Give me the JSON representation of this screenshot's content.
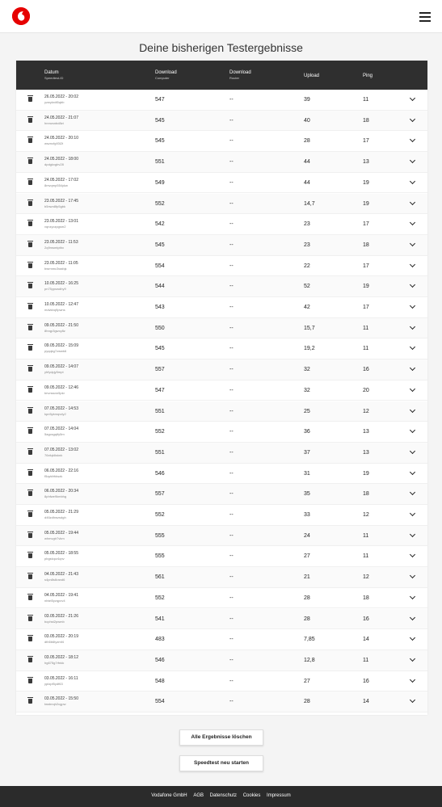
{
  "header": {
    "logo_icon": "vodafone-logo-icon",
    "menu_icon": "hamburger-menu-icon"
  },
  "page": {
    "title": "Deine bisherigen Testergebnisse"
  },
  "table": {
    "columns": {
      "date": "Datum",
      "date_sub": "Speedtest-ID",
      "download": "Download",
      "download_sub": "Computer",
      "router": "Download",
      "router_sub": "Router",
      "upload": "Upload",
      "ping": "Ping"
    },
    "rows": [
      {
        "date": "26.05.2022 - 20:02",
        "id": "yzwykrdt5qbb",
        "dl": "547",
        "router": "--",
        "up": "39",
        "ping": "11"
      },
      {
        "date": "24.05.2022 - 21:07",
        "id": "hnmzsnbd8zt",
        "dl": "545",
        "router": "--",
        "up": "40",
        "ping": "18"
      },
      {
        "date": "24.05.2022 - 20:10",
        "id": "wszncfg93i2t",
        "dl": "545",
        "router": "--",
        "up": "28",
        "ping": "17"
      },
      {
        "date": "24.05.2022 - 18:00",
        "id": "dpdgkxgbv28",
        "dl": "551",
        "router": "--",
        "up": "44",
        "ping": "13"
      },
      {
        "date": "24.05.2022 - 17:02",
        "id": "8mvqmp554ykw",
        "dl": "549",
        "router": "--",
        "up": "44",
        "ping": "19"
      },
      {
        "date": "23.05.2022 - 17:45",
        "id": "b5nwn8fp5gbk",
        "dl": "552",
        "router": "--",
        "up": "14,7",
        "ping": "19"
      },
      {
        "date": "23.05.2022 - 13:01",
        "id": "vqnzyczpgsm2",
        "dl": "542",
        "router": "--",
        "up": "23",
        "ping": "17"
      },
      {
        "date": "23.05.2022 - 11:53",
        "id": "2q9msmtpthx",
        "dl": "545",
        "router": "--",
        "up": "23",
        "ping": "18"
      },
      {
        "date": "23.05.2022 - 11:05",
        "id": "bwrmmc3wsfqk",
        "dl": "554",
        "router": "--",
        "up": "22",
        "ping": "17"
      },
      {
        "date": "10.05.2022 - 16:25",
        "id": "pn75ypswdhy9",
        "dl": "544",
        "router": "--",
        "up": "52",
        "ping": "19"
      },
      {
        "date": "10.05.2022 - 12:47",
        "id": "mdvkbq9pwns",
        "dl": "543",
        "router": "--",
        "up": "42",
        "ping": "17"
      },
      {
        "date": "09.05.2022 - 21:50",
        "id": "8hrqp3gwcy8z",
        "dl": "550",
        "router": "--",
        "up": "15,7",
        "ping": "11"
      },
      {
        "date": "09.05.2022 - 15:09",
        "id": "pyqqkg7zwwk6",
        "dl": "545",
        "router": "--",
        "up": "19,2",
        "ping": "11"
      },
      {
        "date": "09.05.2022 - 14:07",
        "id": "yhfydpjy5mpt",
        "dl": "557",
        "router": "--",
        "up": "32",
        "ping": "16"
      },
      {
        "date": "09.05.2022 - 12:46",
        "id": "tmvnssnn5pkr",
        "dl": "547",
        "router": "--",
        "up": "32",
        "ping": "20"
      },
      {
        "date": "07.05.2022 - 14:53",
        "id": "kpn5ykmqvdy2",
        "dl": "551",
        "router": "--",
        "up": "25",
        "ping": "12"
      },
      {
        "date": "07.05.2022 - 14:04",
        "id": "5agcsgqify5m",
        "dl": "552",
        "router": "--",
        "up": "36",
        "ping": "13"
      },
      {
        "date": "07.05.2022 - 13:02",
        "id": "76xfqk6sknk",
        "dl": "551",
        "router": "--",
        "up": "37",
        "ping": "13"
      },
      {
        "date": "06.05.2022 - 22:16",
        "id": "f5qvkfrfdwzk",
        "dl": "546",
        "router": "--",
        "up": "31",
        "ping": "19"
      },
      {
        "date": "06.05.2022 - 20:34",
        "id": "8phfwe9kmbhg",
        "dl": "557",
        "router": "--",
        "up": "35",
        "ping": "18"
      },
      {
        "date": "05.05.2022 - 21:29",
        "id": "d46zdhwzsdgh",
        "dl": "552",
        "router": "--",
        "up": "33",
        "ping": "12"
      },
      {
        "date": "05.05.2022 - 19:44",
        "id": "whmvgtr7vkm",
        "dl": "555",
        "router": "--",
        "up": "24",
        "ping": "11"
      },
      {
        "date": "05.05.2022 - 18:55",
        "id": "pbgstcpz4qnv",
        "dl": "555",
        "router": "--",
        "up": "27",
        "ping": "11"
      },
      {
        "date": "04.05.2022 - 21:43",
        "id": "s4pn8s6rand6",
        "dl": "561",
        "router": "--",
        "up": "21",
        "ping": "12"
      },
      {
        "date": "04.05.2022 - 19:41",
        "id": "nbtzt5yzqpcv4",
        "dl": "552",
        "router": "--",
        "up": "28",
        "ping": "18"
      },
      {
        "date": "03.05.2022 - 21:26",
        "id": "bcphst2pwmb",
        "dl": "541",
        "router": "--",
        "up": "28",
        "ping": "16"
      },
      {
        "date": "03.05.2022 - 20:19",
        "id": "dth5b6tyzmf4",
        "dl": "483",
        "router": "--",
        "up": "7,85",
        "ping": "14"
      },
      {
        "date": "03.05.2022 - 18:12",
        "id": "hg675g7rfnkk",
        "dl": "546",
        "router": "--",
        "up": "12,8",
        "ping": "11"
      },
      {
        "date": "03.05.2022 - 16:11",
        "id": "yptzpf5ydf63",
        "dl": "548",
        "router": "--",
        "up": "27",
        "ping": "16"
      },
      {
        "date": "03.05.2022 - 15:50",
        "id": "twsbnqh2cgpw",
        "dl": "554",
        "router": "--",
        "up": "28",
        "ping": "14"
      }
    ]
  },
  "buttons": {
    "delete_all": "Alle Ergebnisse löschen",
    "restart": "Speedtest neu starten"
  },
  "footer": {
    "links": [
      "Vodafone GmbH",
      "AGB",
      "Datenschutz",
      "Cookies",
      "Impressum"
    ]
  },
  "colors": {
    "brand": "#e60000",
    "header_bg": "#2f2f2f",
    "footer_bg": "#2b2b2b"
  }
}
